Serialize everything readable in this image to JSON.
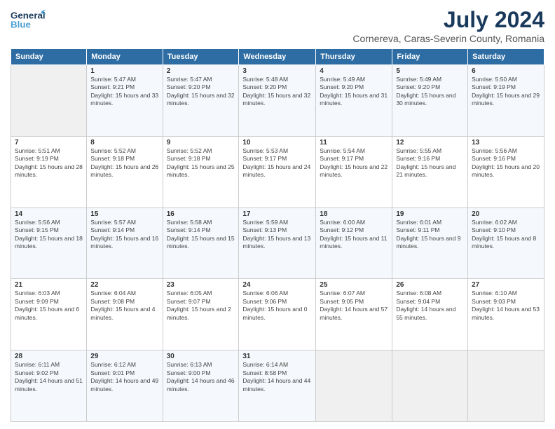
{
  "header": {
    "logo_line1": "General",
    "logo_line2": "Blue",
    "month": "July 2024",
    "location": "Cornereva, Caras-Severin County, Romania"
  },
  "days": [
    "Sunday",
    "Monday",
    "Tuesday",
    "Wednesday",
    "Thursday",
    "Friday",
    "Saturday"
  ],
  "weeks": [
    [
      {
        "date": "",
        "empty": true
      },
      {
        "date": "1",
        "sunrise": "5:47 AM",
        "sunset": "9:21 PM",
        "daylight": "15 hours and 33 minutes."
      },
      {
        "date": "2",
        "sunrise": "5:47 AM",
        "sunset": "9:20 PM",
        "daylight": "15 hours and 32 minutes."
      },
      {
        "date": "3",
        "sunrise": "5:48 AM",
        "sunset": "9:20 PM",
        "daylight": "15 hours and 32 minutes."
      },
      {
        "date": "4",
        "sunrise": "5:49 AM",
        "sunset": "9:20 PM",
        "daylight": "15 hours and 31 minutes."
      },
      {
        "date": "5",
        "sunrise": "5:49 AM",
        "sunset": "9:20 PM",
        "daylight": "15 hours and 30 minutes."
      },
      {
        "date": "6",
        "sunrise": "5:50 AM",
        "sunset": "9:19 PM",
        "daylight": "15 hours and 29 minutes."
      }
    ],
    [
      {
        "date": "7",
        "sunrise": "5:51 AM",
        "sunset": "9:19 PM",
        "daylight": "15 hours and 28 minutes."
      },
      {
        "date": "8",
        "sunrise": "5:52 AM",
        "sunset": "9:18 PM",
        "daylight": "15 hours and 26 minutes."
      },
      {
        "date": "9",
        "sunrise": "5:52 AM",
        "sunset": "9:18 PM",
        "daylight": "15 hours and 25 minutes."
      },
      {
        "date": "10",
        "sunrise": "5:53 AM",
        "sunset": "9:17 PM",
        "daylight": "15 hours and 24 minutes."
      },
      {
        "date": "11",
        "sunrise": "5:54 AM",
        "sunset": "9:17 PM",
        "daylight": "15 hours and 22 minutes."
      },
      {
        "date": "12",
        "sunrise": "5:55 AM",
        "sunset": "9:16 PM",
        "daylight": "15 hours and 21 minutes."
      },
      {
        "date": "13",
        "sunrise": "5:56 AM",
        "sunset": "9:16 PM",
        "daylight": "15 hours and 20 minutes."
      }
    ],
    [
      {
        "date": "14",
        "sunrise": "5:56 AM",
        "sunset": "9:15 PM",
        "daylight": "15 hours and 18 minutes."
      },
      {
        "date": "15",
        "sunrise": "5:57 AM",
        "sunset": "9:14 PM",
        "daylight": "15 hours and 16 minutes."
      },
      {
        "date": "16",
        "sunrise": "5:58 AM",
        "sunset": "9:14 PM",
        "daylight": "15 hours and 15 minutes."
      },
      {
        "date": "17",
        "sunrise": "5:59 AM",
        "sunset": "9:13 PM",
        "daylight": "15 hours and 13 minutes."
      },
      {
        "date": "18",
        "sunrise": "6:00 AM",
        "sunset": "9:12 PM",
        "daylight": "15 hours and 11 minutes."
      },
      {
        "date": "19",
        "sunrise": "6:01 AM",
        "sunset": "9:11 PM",
        "daylight": "15 hours and 9 minutes."
      },
      {
        "date": "20",
        "sunrise": "6:02 AM",
        "sunset": "9:10 PM",
        "daylight": "15 hours and 8 minutes."
      }
    ],
    [
      {
        "date": "21",
        "sunrise": "6:03 AM",
        "sunset": "9:09 PM",
        "daylight": "15 hours and 6 minutes."
      },
      {
        "date": "22",
        "sunrise": "6:04 AM",
        "sunset": "9:08 PM",
        "daylight": "15 hours and 4 minutes."
      },
      {
        "date": "23",
        "sunrise": "6:05 AM",
        "sunset": "9:07 PM",
        "daylight": "15 hours and 2 minutes."
      },
      {
        "date": "24",
        "sunrise": "6:06 AM",
        "sunset": "9:06 PM",
        "daylight": "15 hours and 0 minutes."
      },
      {
        "date": "25",
        "sunrise": "6:07 AM",
        "sunset": "9:05 PM",
        "daylight": "14 hours and 57 minutes."
      },
      {
        "date": "26",
        "sunrise": "6:08 AM",
        "sunset": "9:04 PM",
        "daylight": "14 hours and 55 minutes."
      },
      {
        "date": "27",
        "sunrise": "6:10 AM",
        "sunset": "9:03 PM",
        "daylight": "14 hours and 53 minutes."
      }
    ],
    [
      {
        "date": "28",
        "sunrise": "6:11 AM",
        "sunset": "9:02 PM",
        "daylight": "14 hours and 51 minutes."
      },
      {
        "date": "29",
        "sunrise": "6:12 AM",
        "sunset": "9:01 PM",
        "daylight": "14 hours and 49 minutes."
      },
      {
        "date": "30",
        "sunrise": "6:13 AM",
        "sunset": "9:00 PM",
        "daylight": "14 hours and 46 minutes."
      },
      {
        "date": "31",
        "sunrise": "6:14 AM",
        "sunset": "8:58 PM",
        "daylight": "14 hours and 44 minutes."
      },
      {
        "date": "",
        "empty": true
      },
      {
        "date": "",
        "empty": true
      },
      {
        "date": "",
        "empty": true
      }
    ]
  ]
}
